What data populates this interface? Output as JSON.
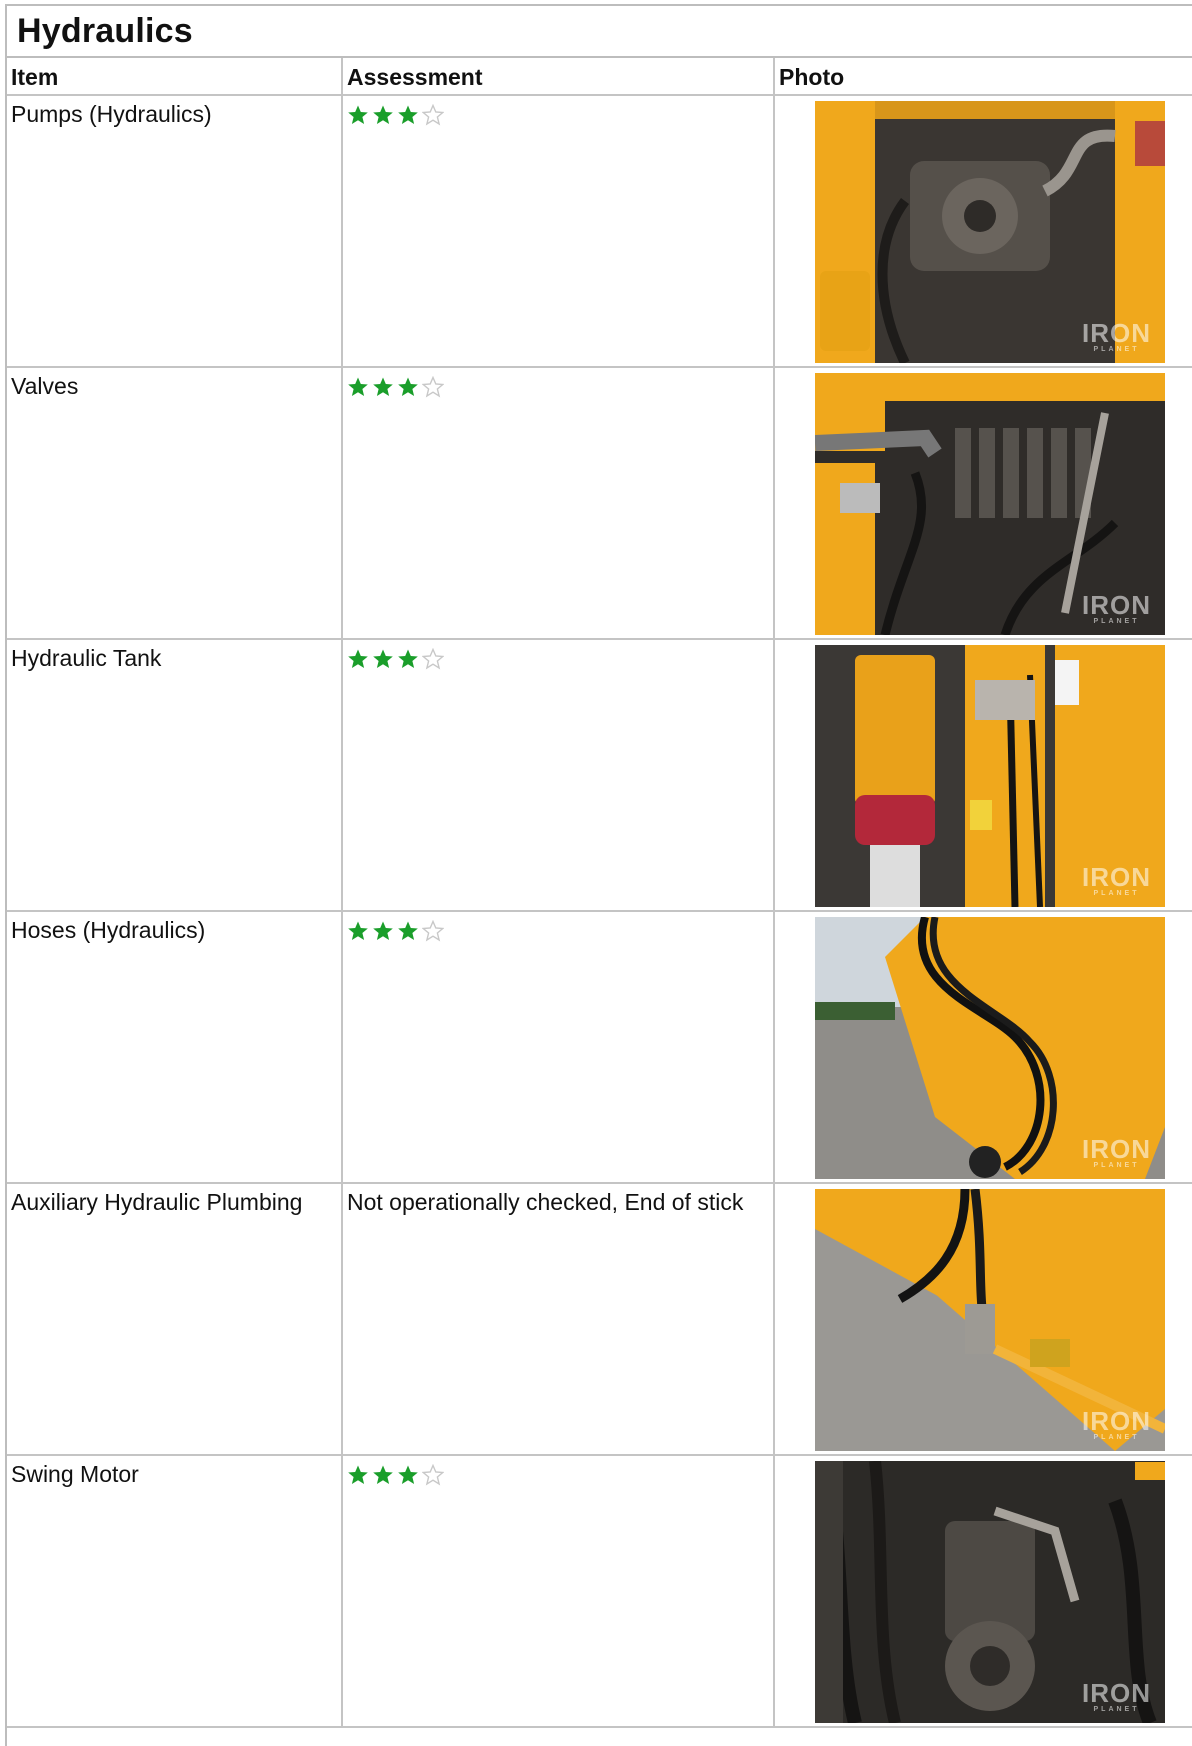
{
  "section": {
    "title": "Hydraulics"
  },
  "columns": {
    "item": "Item",
    "assessment": "Assessment",
    "photo": "Photo"
  },
  "colors": {
    "star_filled": "#1a9e2a",
    "star_empty": "#c8c8c8",
    "machine_yellow": "#f0a81c"
  },
  "watermark": {
    "brand": "IRON",
    "sub": "PLANET"
  },
  "rows": [
    {
      "item": "Pumps (Hydraulics)",
      "assessment_text": "",
      "rating": 3,
      "rating_max": 4,
      "photo_icon": "hydraulic-pump-photo"
    },
    {
      "item": "Valves",
      "assessment_text": "",
      "rating": 3,
      "rating_max": 4,
      "photo_icon": "control-valves-photo"
    },
    {
      "item": "Hydraulic Tank",
      "assessment_text": "",
      "rating": 3,
      "rating_max": 4,
      "photo_icon": "hydraulic-tank-photo"
    },
    {
      "item": "Hoses (Hydraulics)",
      "assessment_text": "",
      "rating": 3,
      "rating_max": 4,
      "photo_icon": "boom-hoses-photo"
    },
    {
      "item": "Auxiliary Hydraulic Plumbing",
      "assessment_text": "Not operationally checked, End of stick",
      "rating": 0,
      "rating_max": 0,
      "photo_icon": "aux-plumbing-photo"
    },
    {
      "item": "Swing Motor",
      "assessment_text": "",
      "rating": 3,
      "rating_max": 4,
      "photo_icon": "swing-motor-photo"
    }
  ]
}
